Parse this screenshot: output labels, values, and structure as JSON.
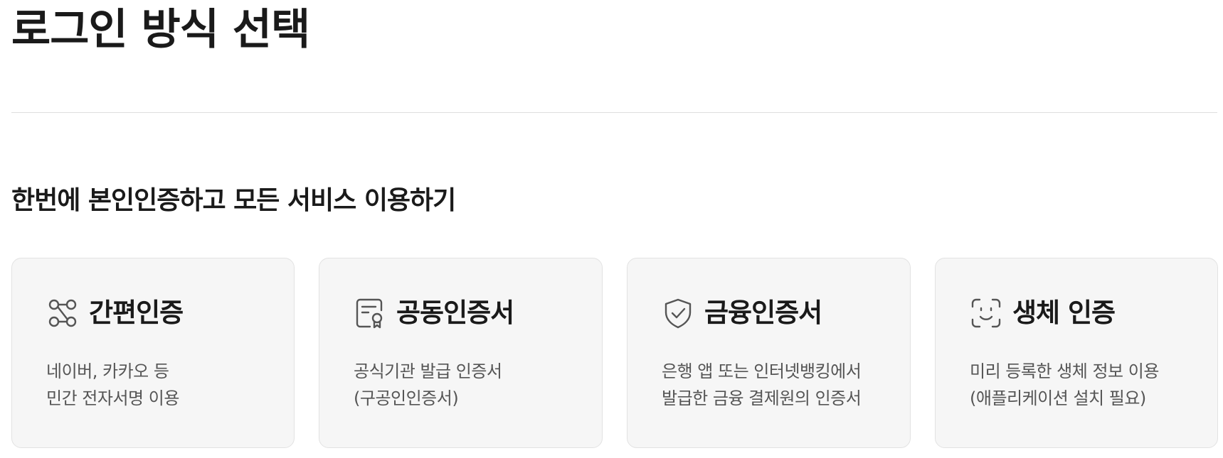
{
  "page": {
    "title": "로그인 방식 선택",
    "section_heading": "한번에 본인인증하고 모든 서비스 이용하기"
  },
  "login_methods": [
    {
      "icon": "simple-auth-icon",
      "title": "간편인증",
      "desc_line1": "네이버, 카카오 등",
      "desc_line2": "민간 전자서명 이용"
    },
    {
      "icon": "certificate-icon",
      "title": "공동인증서",
      "desc_line1": "공식기관 발급 인증서",
      "desc_line2": "(구공인인증서)"
    },
    {
      "icon": "shield-check-icon",
      "title": "금융인증서",
      "desc_line1": "은행 앱 또는 인터넷뱅킹에서",
      "desc_line2": "발급한 금융 결제원의 인증서"
    },
    {
      "icon": "face-scan-icon",
      "title": "생체 인증",
      "desc_line1": "미리 등록한 생체 정보 이용",
      "desc_line2": "(애플리케이션 설치 필요)"
    }
  ],
  "colors": {
    "text": "#1a1a1a",
    "muted_text": "#555555",
    "card_bg": "#f6f6f6",
    "card_border": "#e2e2e2",
    "icon": "#555555"
  }
}
